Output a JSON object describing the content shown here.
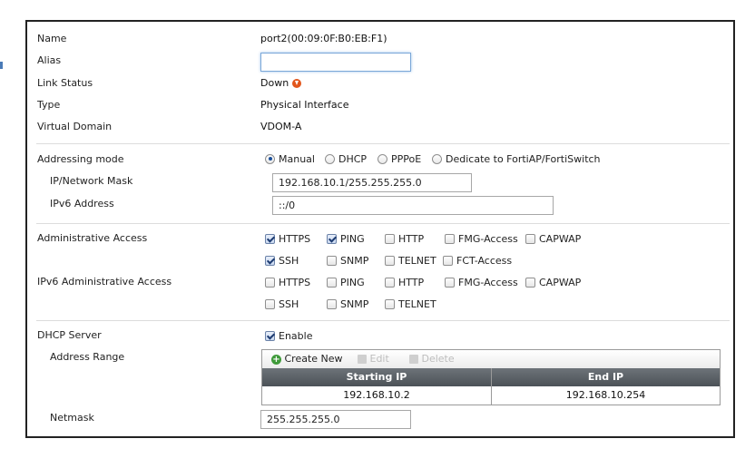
{
  "interface": {
    "name_label": "Name",
    "name_value": "port2(00:09:0F:B0:EB:F1)",
    "alias_label": "Alias",
    "alias_value": "",
    "link_status_label": "Link Status",
    "link_status_value": "Down",
    "link_status_icon": "down-arrow-icon",
    "type_label": "Type",
    "type_value": "Physical Interface",
    "vdom_label": "Virtual Domain",
    "vdom_value": "VDOM-A"
  },
  "addressing": {
    "mode_label": "Addressing mode",
    "modes": [
      {
        "label": "Manual",
        "selected": true
      },
      {
        "label": "DHCP",
        "selected": false
      },
      {
        "label": "PPPoE",
        "selected": false
      },
      {
        "label": "Dedicate to FortiAP/FortiSwitch",
        "selected": false
      }
    ],
    "ip_label": "IP/Network Mask",
    "ip_value": "192.168.10.1/255.255.255.0",
    "ipv6_label": "IPv6 Address",
    "ipv6_value": "::/0"
  },
  "admin_access": {
    "label": "Administrative Access",
    "options": [
      {
        "label": "HTTPS",
        "checked": true
      },
      {
        "label": "PING",
        "checked": true
      },
      {
        "label": "HTTP",
        "checked": false
      },
      {
        "label": "FMG-Access",
        "checked": false
      },
      {
        "label": "CAPWAP",
        "checked": false
      },
      {
        "label": "SSH",
        "checked": true
      },
      {
        "label": "SNMP",
        "checked": false
      },
      {
        "label": "TELNET",
        "checked": false
      },
      {
        "label": "FCT-Access",
        "checked": false
      }
    ]
  },
  "ipv6_admin_access": {
    "label": "IPv6 Administrative Access",
    "options": [
      {
        "label": "HTTPS",
        "checked": false
      },
      {
        "label": "PING",
        "checked": false
      },
      {
        "label": "HTTP",
        "checked": false
      },
      {
        "label": "FMG-Access",
        "checked": false
      },
      {
        "label": "CAPWAP",
        "checked": false
      },
      {
        "label": "SSH",
        "checked": false
      },
      {
        "label": "SNMP",
        "checked": false
      },
      {
        "label": "TELNET",
        "checked": false
      }
    ]
  },
  "dhcp": {
    "label": "DHCP Server",
    "enable_label": "Enable",
    "enabled": true,
    "range_label": "Address Range",
    "toolbar": {
      "create_new": "Create New",
      "edit": "Edit",
      "delete": "Delete"
    },
    "columns": [
      "Starting IP",
      "End IP"
    ],
    "rows": [
      [
        "192.168.10.2",
        "192.168.10.254"
      ]
    ],
    "netmask_label": "Netmask",
    "netmask_value": "255.255.255.0"
  },
  "colors": {
    "accent": "#1a4f9a",
    "header_bg": "#565c61",
    "down_icon": "#e2561c",
    "create_icon": "#3f9a3a"
  }
}
